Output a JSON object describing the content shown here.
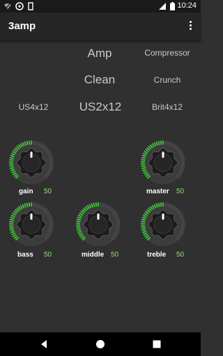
{
  "status_bar": {
    "time": "10:24"
  },
  "app": {
    "title": "3amp"
  },
  "selectors": {
    "amp": "Amp",
    "compressor": "Compressor",
    "clean": "Clean",
    "crunch": "Crunch",
    "us4x12": "US4x12",
    "us2x12": "US2x12",
    "brit4x12": "Brit4x12"
  },
  "knobs": {
    "gain": {
      "label": "gain",
      "value": "50"
    },
    "master": {
      "label": "master",
      "value": "50"
    },
    "bass": {
      "label": "bass",
      "value": "50"
    },
    "middle": {
      "label": "middle",
      "value": "50"
    },
    "treble": {
      "label": "treble",
      "value": "50"
    }
  },
  "colors": {
    "accent": "#3fcf3a",
    "value_text": "#8ee07a",
    "background": "#303030"
  }
}
